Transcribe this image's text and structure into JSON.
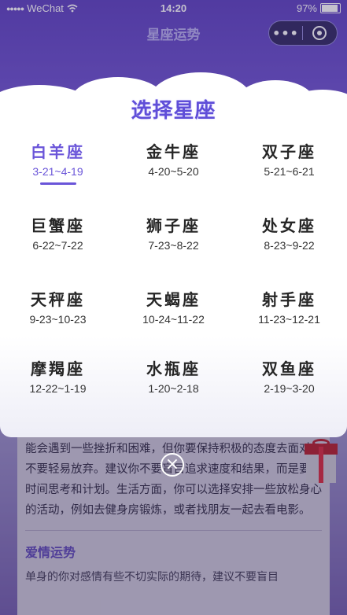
{
  "status_bar": {
    "carrier": "WeChat",
    "time": "14:20",
    "battery": "97%"
  },
  "nav": {
    "title": "星座运势",
    "more": "•••"
  },
  "article": {
    "paragraph": "整体运势并不是很好，因此你需要小心谨慎地面对一切。可能会遇到一些挫折和困难，但你要保持积极的态度去面对，不要轻易放弃。建议你不要盲目追求速度和结果，而是要花时间思考和计划。生活方面，你可以选择安排一些放松身心的活动，例如去健身房锻炼，或者找朋友一起去看电影。",
    "love_heading": "爱情运势",
    "love_text": "单身的你对感情有些不切实际的期待，建议不要盲目"
  },
  "modal": {
    "title": "选择星座",
    "signs": [
      {
        "name": "白羊座",
        "date": "3-21~4-19",
        "active": true
      },
      {
        "name": "金牛座",
        "date": "4-20~5-20"
      },
      {
        "name": "双子座",
        "date": "5-21~6-21"
      },
      {
        "name": "巨蟹座",
        "date": "6-22~7-22"
      },
      {
        "name": "狮子座",
        "date": "7-23~8-22"
      },
      {
        "name": "处女座",
        "date": "8-23~9-22"
      },
      {
        "name": "天秤座",
        "date": "9-23~10-23"
      },
      {
        "name": "天蝎座",
        "date": "10-24~11-22"
      },
      {
        "name": "射手座",
        "date": "11-23~12-21"
      },
      {
        "name": "摩羯座",
        "date": "12-22~1-19"
      },
      {
        "name": "水瓶座",
        "date": "1-20~2-18"
      },
      {
        "name": "双鱼座",
        "date": "2-19~3-20"
      }
    ],
    "close_icon": "close-circle-icon"
  }
}
